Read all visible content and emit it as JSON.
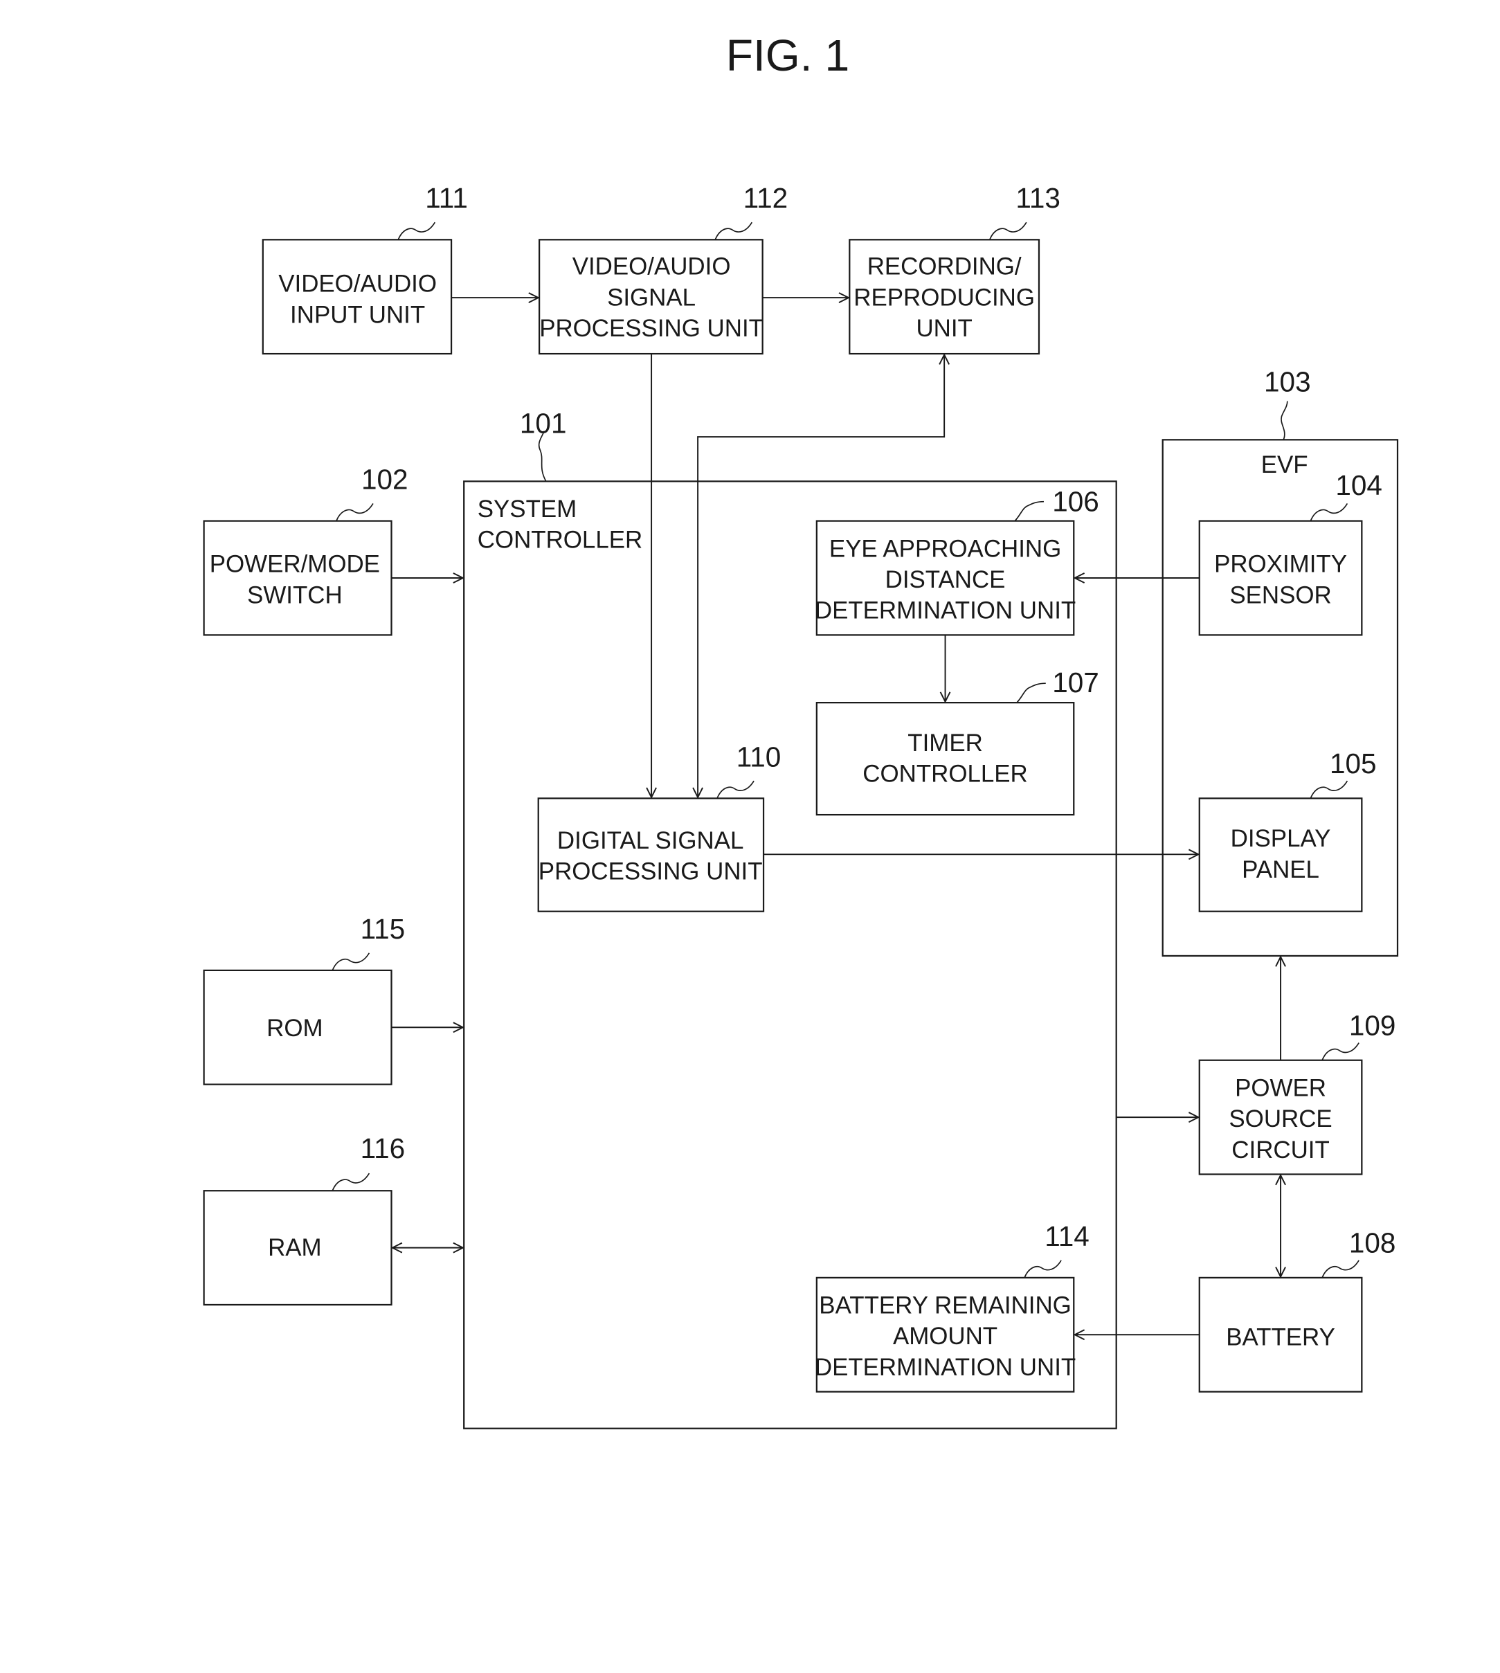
{
  "figure": {
    "title": "FIG. 1"
  },
  "blocks": {
    "video_audio_input": {
      "ref": "111",
      "lines": [
        "VIDEO/AUDIO",
        "INPUT UNIT"
      ]
    },
    "video_audio_signal_processing": {
      "ref": "112",
      "lines": [
        "VIDEO/AUDIO",
        "SIGNAL",
        "PROCESSING UNIT"
      ]
    },
    "recording_reproducing": {
      "ref": "113",
      "lines": [
        "RECORDING/",
        "REPRODUCING",
        "UNIT"
      ]
    },
    "system_controller": {
      "ref": "101",
      "lines": [
        "SYSTEM",
        "CONTROLLER"
      ]
    },
    "power_mode_switch": {
      "ref": "102",
      "lines": [
        "POWER/MODE",
        "SWITCH"
      ]
    },
    "evf": {
      "ref": "103",
      "lines": [
        "EVF"
      ]
    },
    "proximity_sensor": {
      "ref": "104",
      "lines": [
        "PROXIMITY",
        "SENSOR"
      ]
    },
    "display_panel": {
      "ref": "105",
      "lines": [
        "DISPLAY",
        "PANEL"
      ]
    },
    "eye_approaching": {
      "ref": "106",
      "lines": [
        "EYE APPROACHING",
        "DISTANCE",
        "DETERMINATION UNIT"
      ]
    },
    "timer_controller": {
      "ref": "107",
      "lines": [
        "TIMER",
        "CONTROLLER"
      ]
    },
    "battery": {
      "ref": "108",
      "lines": [
        "BATTERY"
      ]
    },
    "power_source_circuit": {
      "ref": "109",
      "lines": [
        "POWER",
        "SOURCE",
        "CIRCUIT"
      ]
    },
    "digital_signal_processing": {
      "ref": "110",
      "lines": [
        "DIGITAL SIGNAL",
        "PROCESSING UNIT"
      ]
    },
    "battery_remaining": {
      "ref": "114",
      "lines": [
        "BATTERY REMAINING",
        "AMOUNT",
        "DETERMINATION UNIT"
      ]
    },
    "rom": {
      "ref": "115",
      "lines": [
        "ROM"
      ]
    },
    "ram": {
      "ref": "116",
      "lines": [
        "RAM"
      ]
    }
  },
  "connections": [
    {
      "from": "111",
      "to": "112",
      "direction": "one-way"
    },
    {
      "from": "112",
      "to": "113",
      "direction": "one-way"
    },
    {
      "from": "112",
      "to": "110",
      "direction": "one-way"
    },
    {
      "from": "110",
      "to": "113",
      "direction": "two-way"
    },
    {
      "from": "102",
      "to": "101",
      "direction": "one-way"
    },
    {
      "from": "104",
      "to": "106",
      "direction": "one-way"
    },
    {
      "from": "106",
      "to": "107",
      "direction": "one-way"
    },
    {
      "from": "110",
      "to": "105",
      "direction": "one-way"
    },
    {
      "from": "115",
      "to": "101",
      "direction": "one-way"
    },
    {
      "from": "116",
      "to": "101",
      "direction": "two-way"
    },
    {
      "from": "101",
      "to": "109",
      "direction": "one-way"
    },
    {
      "from": "109",
      "to": "103",
      "direction": "one-way"
    },
    {
      "from": "109",
      "to": "108",
      "direction": "two-way"
    },
    {
      "from": "108",
      "to": "114",
      "direction": "one-way"
    }
  ]
}
